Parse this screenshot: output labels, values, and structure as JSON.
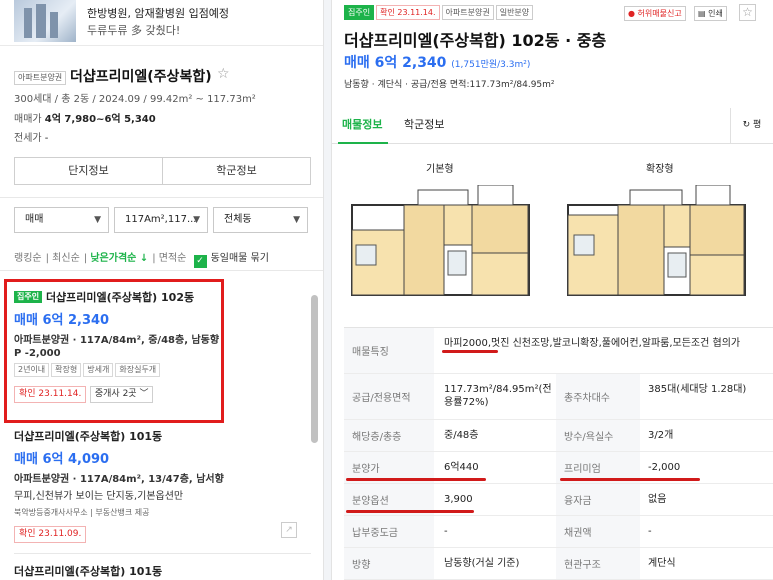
{
  "banner": {
    "line1": "한방병원, 암재활병원 입점예정",
    "line2": "두류두류 多 갖췄다!"
  },
  "complex": {
    "type_tag": "아파트분양권",
    "name": "더샵프리미엘(주상복합)",
    "star": "☆",
    "summary": "300세대 / 총 2동 / 2024.09 / 99.42m² ~ 117.73m²",
    "sale_label": "매매가",
    "sale_value": "4억 7,980~6억 5,340",
    "jeonse_label": "전세가",
    "jeonse_value": "-"
  },
  "tabs_left": [
    "단지정보",
    "학군정보"
  ],
  "filters": {
    "trade": "매매",
    "area": "117Am²,117...",
    "dong": "전체동"
  },
  "sorts": {
    "ranking": "랭킹순",
    "latest": "최신순",
    "low_price": "낮은가격순 ↓",
    "area": "면적순",
    "same_listing": "동일매물 묶기",
    "check": "✓"
  },
  "listings": [
    {
      "badge": "집주인",
      "title": "더샵프리미엘(주상복합) 102동",
      "price": "매매 6억 2,340",
      "meta": "아파트분양권 · 117A/84m², 중/48층, 남동향",
      "premium": "P -2,000",
      "tags": [
        "2년이내",
        "확장형",
        "방세개",
        "화장실두개"
      ],
      "confirm": "확인 23.11.14.",
      "agent": "중개사 2곳 ﹀"
    },
    {
      "title": "더샵프리미엘(주상복합) 101동",
      "price": "매매 6억 4,090",
      "meta": "아파트분양권 · 117A/84m², 13/47층, 남서향",
      "desc": "무피,신천뷰가 보이는 단지동,기본옵션만",
      "provider": "북악방등중개사사무소 | 부동산뱅크 제공",
      "confirm": "확인 23.11.09."
    },
    {
      "title": "더샵프리미엘(주상복합) 101동"
    }
  ],
  "detail": {
    "badges": [
      "집주인",
      "확인 23.11.14.",
      "아파트분양권",
      "일반분양"
    ],
    "report": "허위매물신고",
    "print": "인쇄",
    "title": "더샵프리미엘(주상복합) 102동 · 중층",
    "price": "매매 6억 2,340",
    "price_sub": "(1,751만원/3.3m²)",
    "facing": "남동향",
    "stairs": "계단식",
    "area": "공급/전용 면적:117.73m²/84.95m²",
    "tabs": [
      "매물정보",
      "학군정보"
    ],
    "refresh": "↻ 평",
    "plan_labels": [
      "기본형",
      "확장형"
    ],
    "rows": [
      {
        "label": "매물특징",
        "value": "마피2000,멋진 신천조망,발코니확장,풀에어컨,알파룸,모든조건 협의가"
      },
      {
        "label": "공급/전용면적",
        "value": "117.73m²/84.95m²(전용률72%)",
        "label2": "총주차대수",
        "value2": "385대(세대당 1.28대)"
      },
      {
        "label": "해당층/총층",
        "value": "중/48층",
        "label2": "방수/욕실수",
        "value2": "3/2개"
      },
      {
        "label": "분양가",
        "value": "6억440",
        "label2": "프리미엄",
        "value2": "-2,000"
      },
      {
        "label": "분양옵션",
        "value": "3,900",
        "label2": "융자금",
        "value2": "없음"
      },
      {
        "label": "납부중도금",
        "value": "-",
        "label2": "채권액",
        "value2": "-"
      },
      {
        "label": "방향",
        "value": "남동향(거실 기준)",
        "label2": "현관구조",
        "value2": "계단식"
      }
    ]
  },
  "colors": {
    "accent_green": "#1db34a",
    "price_blue": "#2b6ef0",
    "highlight_red": "#e11c1c"
  }
}
